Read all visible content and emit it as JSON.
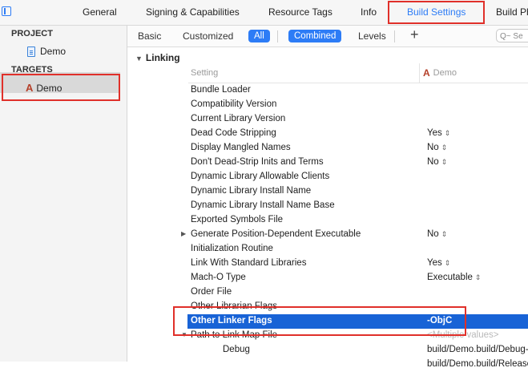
{
  "tabs": [
    "General",
    "Signing & Capabilities",
    "Resource Tags",
    "Info",
    "Build Settings",
    "Build Ph"
  ],
  "active_tab_index": 4,
  "sidebar": {
    "project_header": "PROJECT",
    "project_item": "Demo",
    "targets_header": "TARGETS",
    "target_item": "Demo"
  },
  "filter": {
    "basic": "Basic",
    "customized": "Customized",
    "all": "All",
    "combined": "Combined",
    "levels": "Levels",
    "search_placeholder": "Q~ Se"
  },
  "section": {
    "title": "Linking",
    "col_setting": "Setting",
    "col_target": "Demo"
  },
  "rows": [
    {
      "name": "Bundle Loader",
      "value": ""
    },
    {
      "name": "Compatibility Version",
      "value": ""
    },
    {
      "name": "Current Library Version",
      "value": ""
    },
    {
      "name": "Dead Code Stripping",
      "value": "Yes"
    },
    {
      "name": "Display Mangled Names",
      "value": "No"
    },
    {
      "name": "Don't Dead-Strip Inits and Terms",
      "value": "No"
    },
    {
      "name": "Dynamic Library Allowable Clients",
      "value": ""
    },
    {
      "name": "Dynamic Library Install Name",
      "value": ""
    },
    {
      "name": "Dynamic Library Install Name Base",
      "value": ""
    },
    {
      "name": "Exported Symbols File",
      "value": ""
    },
    {
      "name": "Generate Position-Dependent Executable",
      "value": "No"
    },
    {
      "name": "Initialization Routine",
      "value": ""
    },
    {
      "name": "Link With Standard Libraries",
      "value": "Yes"
    },
    {
      "name": "Mach-O Type",
      "value": "Executable"
    },
    {
      "name": "Order File",
      "value": ""
    },
    {
      "name": "Other Librarian Flags",
      "value": ""
    },
    {
      "name": "Other Linker Flags",
      "value": "-ObjC"
    },
    {
      "name": "Path to Link Map File",
      "value": "<Multiple values>"
    },
    {
      "name": "Debug",
      "value": "build/Demo.build/Debug-"
    },
    {
      "name": "",
      "value": "build/Demo.build/Release-i"
    }
  ],
  "colors": {
    "accent": "#2d7cf6",
    "selection": "#1863d6",
    "highlight_box": "#e0302a"
  }
}
